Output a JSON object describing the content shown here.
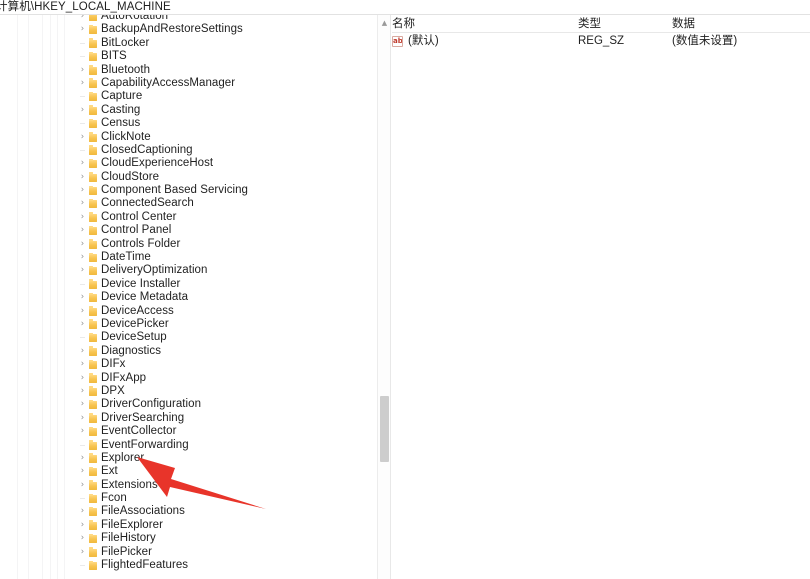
{
  "window": {
    "app_name": "registry-editor"
  },
  "address_bar": {
    "path": "计算机\\HKEY_LOCAL_MACHINE"
  },
  "tree": {
    "scrollbar": {
      "up_arrow_glyph": "▲"
    },
    "expander_glyph": "›",
    "items": [
      {
        "label": "AutoRotation",
        "expandable": true
      },
      {
        "label": "BackupAndRestoreSettings",
        "expandable": true
      },
      {
        "label": "BitLocker",
        "expandable": false
      },
      {
        "label": "BITS",
        "expandable": false
      },
      {
        "label": "Bluetooth",
        "expandable": true
      },
      {
        "label": "CapabilityAccessManager",
        "expandable": true
      },
      {
        "label": "Capture",
        "expandable": false
      },
      {
        "label": "Casting",
        "expandable": true
      },
      {
        "label": "Census",
        "expandable": false
      },
      {
        "label": "ClickNote",
        "expandable": true
      },
      {
        "label": "ClosedCaptioning",
        "expandable": false
      },
      {
        "label": "CloudExperienceHost",
        "expandable": true
      },
      {
        "label": "CloudStore",
        "expandable": true
      },
      {
        "label": "Component Based Servicing",
        "expandable": true
      },
      {
        "label": "ConnectedSearch",
        "expandable": true
      },
      {
        "label": "Control Center",
        "expandable": true
      },
      {
        "label": "Control Panel",
        "expandable": true
      },
      {
        "label": "Controls Folder",
        "expandable": true
      },
      {
        "label": "DateTime",
        "expandable": true
      },
      {
        "label": "DeliveryOptimization",
        "expandable": true
      },
      {
        "label": "Device Installer",
        "expandable": false
      },
      {
        "label": "Device Metadata",
        "expandable": true
      },
      {
        "label": "DeviceAccess",
        "expandable": true
      },
      {
        "label": "DevicePicker",
        "expandable": true
      },
      {
        "label": "DeviceSetup",
        "expandable": false
      },
      {
        "label": "Diagnostics",
        "expandable": true
      },
      {
        "label": "DIFx",
        "expandable": true
      },
      {
        "label": "DIFxApp",
        "expandable": true
      },
      {
        "label": "DPX",
        "expandable": true
      },
      {
        "label": "DriverConfiguration",
        "expandable": true
      },
      {
        "label": "DriverSearching",
        "expandable": true
      },
      {
        "label": "EventCollector",
        "expandable": true
      },
      {
        "label": "EventForwarding",
        "expandable": false
      },
      {
        "label": "Explorer",
        "expandable": true
      },
      {
        "label": "Ext",
        "expandable": true
      },
      {
        "label": "Extensions",
        "expandable": true
      },
      {
        "label": "Fcon",
        "expandable": false
      },
      {
        "label": "FileAssociations",
        "expandable": true
      },
      {
        "label": "FileExplorer",
        "expandable": true
      },
      {
        "label": "FileHistory",
        "expandable": true
      },
      {
        "label": "FilePicker",
        "expandable": true
      },
      {
        "label": "FlightedFeatures",
        "expandable": false
      },
      {
        "label": "",
        "expandable": false
      }
    ]
  },
  "values": {
    "columns": {
      "name": "名称",
      "type": "类型",
      "data": "数据"
    },
    "rows": [
      {
        "icon": "string-value-icon",
        "icon_text": "ab",
        "name": "(默认)",
        "type": "REG_SZ",
        "data": "(数值未设置)"
      }
    ]
  },
  "annotation": {
    "arrow_color": "#e8342a",
    "points_at": "Explorer"
  }
}
